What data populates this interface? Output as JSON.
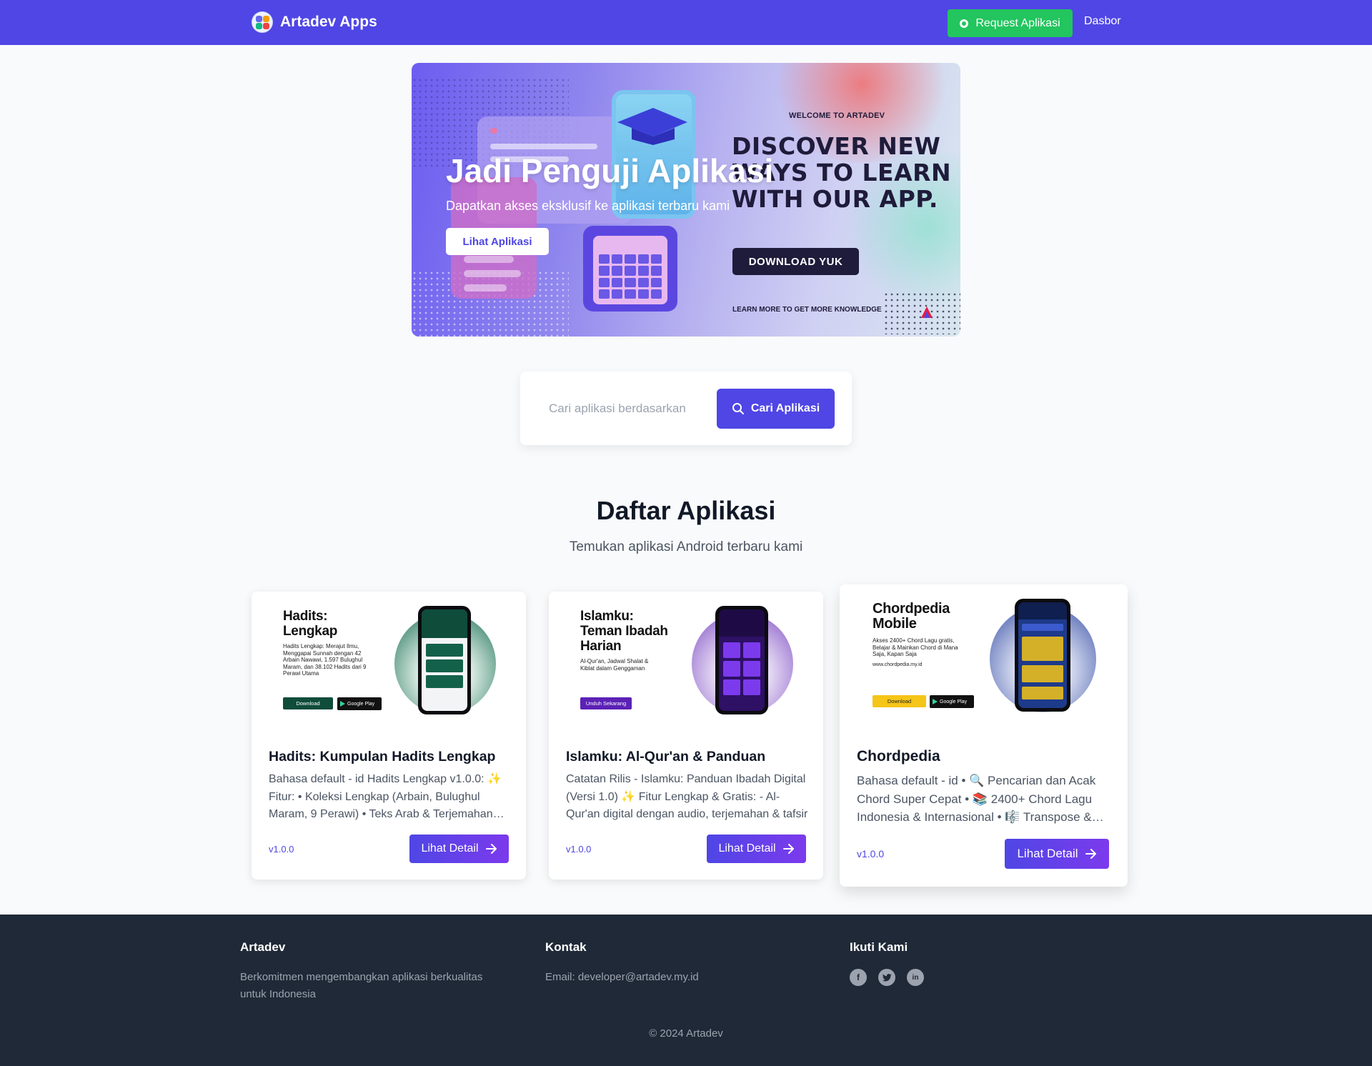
{
  "navbar": {
    "brand": "Artadev Apps",
    "request_label": "Request Aplikasi",
    "dashboard_label": "Dasbor"
  },
  "hero": {
    "title": "Jadi Penguji Aplikasi",
    "subtitle": "Dapatkan akses eksklusif ke aplikasi terbaru kami",
    "button_label": "Lihat Aplikasi",
    "banner": {
      "kicker": "WELCOME TO ARTADEV",
      "headline": "DISCOVER NEW WAYS TO LEARN WITH OUR APP.",
      "button_label": "DOWNLOAD YUK",
      "footer": "LEARN MORE TO GET MORE KNOWLEDGE"
    }
  },
  "search": {
    "placeholder": "Cari aplikasi berdasarkan",
    "button_label": "Cari Aplikasi"
  },
  "section": {
    "title": "Daftar Aplikasi",
    "subtitle": "Temukan aplikasi Android terbaru kami"
  },
  "apps": [
    {
      "promo_title": "Hadits:\nLengkap",
      "promo_desc": "Hadits Lengkap: Merajut Ilmu, Menggapai Sunnah dengan 42 Arbain Nawawi, 1.597 Bulughul Maram, dan 38.102 Hadits dari 9 Perawi Utama",
      "promo_button": "Download",
      "store_label": "Google Play",
      "title": "Hadits: Kumpulan Hadits Lengkap",
      "description": "Bahasa default - id Hadits Lengkap v1.0.0: ✨ Fitur: • Koleksi Lengkap (Arbain, Bulughul Maram, 9 Perawi) • Teks Arab & Terjemahan Indonesia",
      "version": "v1.0.0",
      "button_label": "Lihat Detail",
      "accent": "#0f4c3a"
    },
    {
      "promo_title": "Islamku:\nTeman Ibadah\nHarian",
      "promo_desc": "Al-Qur'an, Jadwal Shalat & Kiblat dalam Genggaman",
      "promo_button": "Unduh Sekarang",
      "title": "Islamku: Al-Qur'an & Panduan",
      "description": "Catatan Rilis - Islamku: Panduan Ibadah Digital (Versi 1.0) ✨ Fitur Lengkap & Gratis: - Al-Qur'an digital dengan audio, terjemahan & tafsir",
      "version": "v1.0.0",
      "button_label": "Lihat Detail",
      "accent": "#5b21b6"
    },
    {
      "promo_title": "Chordpedia\nMobile",
      "promo_desc": "Akses 2400+ Chord Lagu gratis, Belajar & Mainkan Chord di Mana Saja, Kapan Saja",
      "promo_url": "www.chordpedia.my.id",
      "promo_button": "Download",
      "store_label": "Google Play",
      "title": "Chordpedia",
      "description": "Bahasa default - id • 🔍 Pencarian dan Acak Chord Super Cepat • 📚 2400+ Chord Lagu Indonesia & Internasional • 🎼 Transpose & Capo",
      "version": "v1.0.0",
      "button_label": "Lihat Detail",
      "accent": "#f5c518"
    }
  ],
  "footer": {
    "about_title": "Artadev",
    "about_text": "Berkomitmen mengembangkan aplikasi berkualitas untuk Indonesia",
    "contact_title": "Kontak",
    "contact_text": "Email: developer@artadev.my.id",
    "social_title": "Ikuti Kami",
    "social": [
      "facebook-icon",
      "twitter-icon",
      "linkedin-icon"
    ],
    "copyright": "© 2024 Artadev"
  },
  "colors": {
    "primary": "#4f46e5",
    "success": "#22c55e",
    "footer_bg": "#1f2937"
  }
}
